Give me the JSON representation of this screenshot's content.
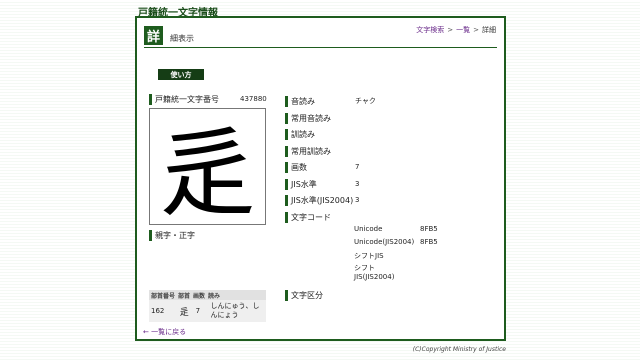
{
  "site_title": "戸籍統一文字情報",
  "header": {
    "badge": "詳",
    "title": "細表示",
    "breadcrumb": {
      "search": "文字検索",
      "list": "一覧",
      "current": "詳細",
      "sep": ">"
    }
  },
  "usage_button": "使い方",
  "left": {
    "id_label": "戸籍統一文字番号",
    "id_value": "437880",
    "glyph": "辵",
    "related_label": "親字・正字",
    "radical_table": {
      "headers": [
        "部首番号",
        "部首",
        "画数",
        "読み"
      ],
      "row": {
        "number": "162",
        "radical": "辵",
        "strokes": "7",
        "reading": "しんにゅう、しんにょう"
      }
    },
    "back_link": "← 一覧に戻る"
  },
  "props": [
    {
      "label": "音読み",
      "value": "チャク"
    },
    {
      "label": "常用音読み",
      "value": ""
    },
    {
      "label": "訓読み",
      "value": ""
    },
    {
      "label": "常用訓読み",
      "value": ""
    },
    {
      "label": "画数",
      "value": "7"
    },
    {
      "label": "JIS水準",
      "value": "3"
    },
    {
      "label": "JIS水準(JIS2004)",
      "value": "3"
    },
    {
      "label": "文字コード",
      "value": ""
    }
  ],
  "char_codes": [
    {
      "name": "Unicode",
      "value": "8FB5"
    },
    {
      "name": "Unicode(JIS2004)",
      "value": "8FB5"
    },
    {
      "name": "シフトJIS",
      "value": ""
    },
    {
      "name": "シフトJIS(JIS2004)",
      "value": ""
    }
  ],
  "char_class_label": "文字区分",
  "footer": "(C)Copyright Ministry of Justice",
  "colors": {
    "accent": "#1e5c1e",
    "link": "#6a2b8a"
  }
}
